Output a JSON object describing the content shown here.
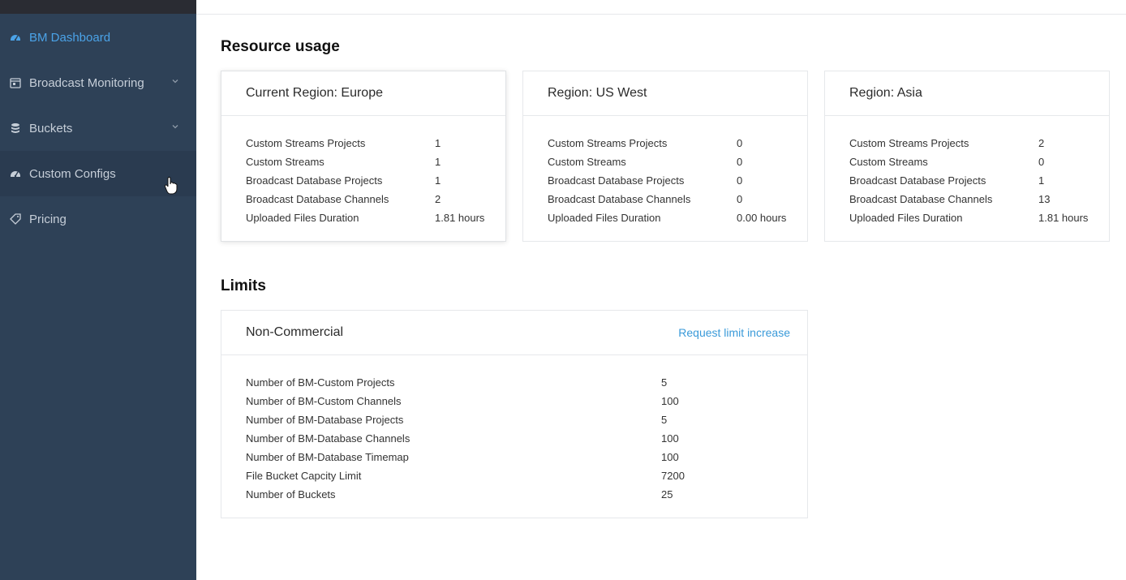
{
  "sidebar": {
    "items": [
      {
        "label": "BM Dashboard",
        "icon": "dashboard-icon"
      },
      {
        "label": "Broadcast Monitoring",
        "icon": "calendar-icon"
      },
      {
        "label": "Buckets",
        "icon": "database-icon"
      },
      {
        "label": "Custom Configs",
        "icon": "dashboard-icon"
      },
      {
        "label": "Pricing",
        "icon": "tag-icon"
      }
    ]
  },
  "resource_usage": {
    "title": "Resource usage",
    "regions": [
      {
        "title": "Current Region: Europe",
        "rows": [
          {
            "label": "Custom Streams Projects",
            "value": "1"
          },
          {
            "label": "Custom Streams",
            "value": "1"
          },
          {
            "label": "Broadcast Database Projects",
            "value": "1"
          },
          {
            "label": "Broadcast Database Channels",
            "value": "2"
          },
          {
            "label": "Uploaded Files Duration",
            "value": "1.81 hours"
          }
        ]
      },
      {
        "title": "Region: US West",
        "rows": [
          {
            "label": "Custom Streams Projects",
            "value": "0"
          },
          {
            "label": "Custom Streams",
            "value": "0"
          },
          {
            "label": "Broadcast Database Projects",
            "value": "0"
          },
          {
            "label": "Broadcast Database Channels",
            "value": "0"
          },
          {
            "label": "Uploaded Files Duration",
            "value": "0.00 hours"
          }
        ]
      },
      {
        "title": "Region: Asia",
        "rows": [
          {
            "label": "Custom Streams Projects",
            "value": "2"
          },
          {
            "label": "Custom Streams",
            "value": "0"
          },
          {
            "label": "Broadcast Database Projects",
            "value": "1"
          },
          {
            "label": "Broadcast Database Channels",
            "value": "13"
          },
          {
            "label": "Uploaded Files Duration",
            "value": "1.81 hours"
          }
        ]
      }
    ]
  },
  "limits": {
    "title": "Limits",
    "plan": "Non-Commercial",
    "request_link": "Request limit increase",
    "rows": [
      {
        "label": "Number of BM-Custom Projects",
        "value": "5"
      },
      {
        "label": "Number of BM-Custom Channels",
        "value": "100"
      },
      {
        "label": "Number of BM-Database Projects",
        "value": "5"
      },
      {
        "label": "Number of BM-Database Channels",
        "value": "100"
      },
      {
        "label": "Number of BM-Database Timemap",
        "value": "100"
      },
      {
        "label": "File Bucket Capcity Limit",
        "value": "7200"
      },
      {
        "label": "Number of Buckets",
        "value": "25"
      }
    ]
  },
  "colors": {
    "sidebar_bg": "#2e4157",
    "accent": "#4ba3e8",
    "link": "#3a9ad9"
  }
}
